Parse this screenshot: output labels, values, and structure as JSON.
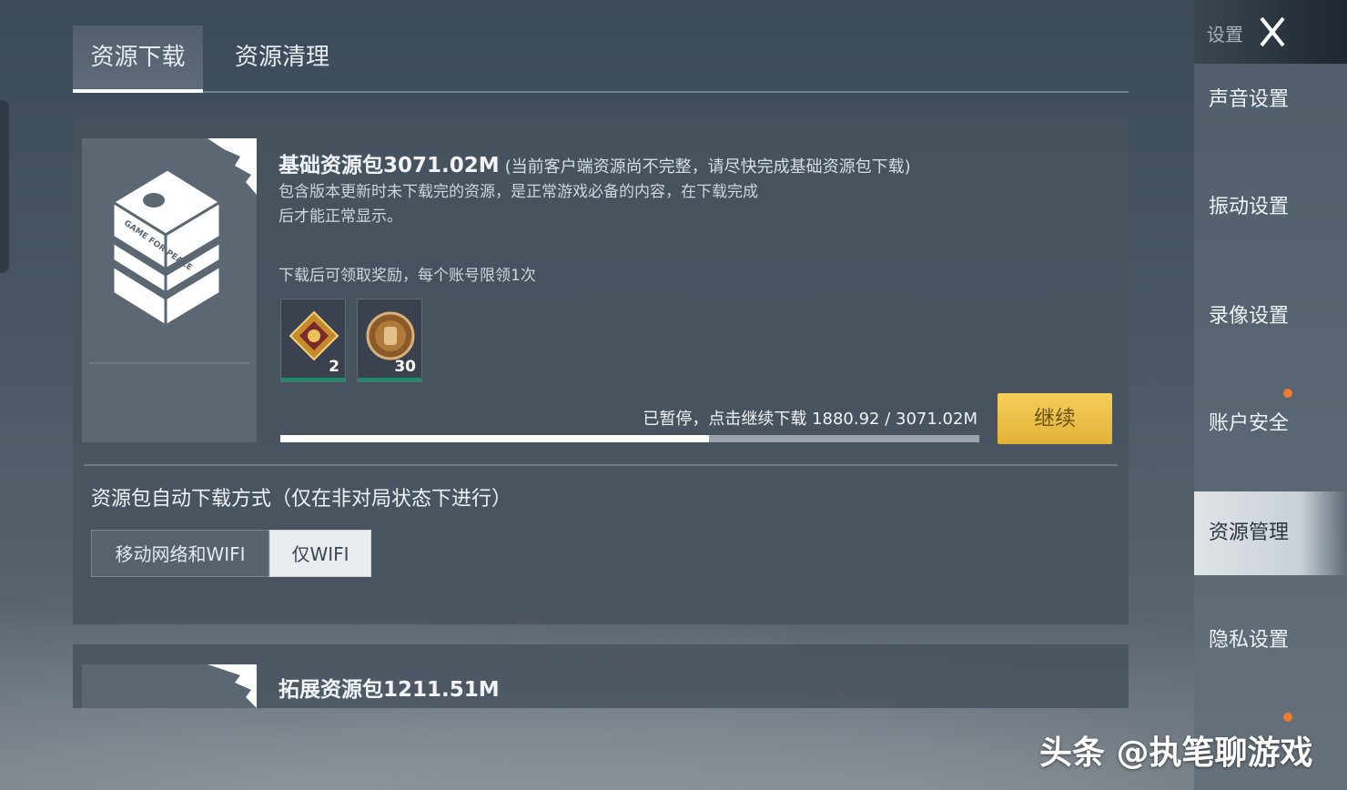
{
  "tabs": [
    {
      "label": "资源下载",
      "active": true
    },
    {
      "label": "资源清理",
      "active": false
    }
  ],
  "base_pack": {
    "title": "基础资源包3071.02M",
    "note": "(当前客户端资源尚不完整，请尽快完成基础资源包下载)",
    "description": "包含版本更新时未下载完的资源，是正常游戏必备的内容，在下载完成后才能正常显示。",
    "image_text": "GAME FOR PEACE",
    "reward_label": "下载后可领取奖励，每个账号限领1次",
    "rewards": [
      {
        "icon": "double-exp-card-icon",
        "count": "2"
      },
      {
        "icon": "armor-coin-icon",
        "count": "30"
      }
    ],
    "status": "已暂停，点击继续下载 1880.92 / 3071.02M",
    "progress": 0.613,
    "continue_label": "继续"
  },
  "auto_download": {
    "label": "资源包自动下载方式（仅在非对局状态下进行）",
    "options": [
      {
        "label": "移动网络和WIFI",
        "selected": false
      },
      {
        "label": "仅WIFI",
        "selected": true
      }
    ]
  },
  "ext_pack": {
    "title": "拓展资源包1211.51M"
  },
  "sidebar": {
    "header": "设置",
    "items": [
      {
        "label": "声音设置"
      },
      {
        "label": "振动设置"
      },
      {
        "label": "录像设置"
      },
      {
        "label": "账户安全"
      },
      {
        "label": "资源管理",
        "active": true
      },
      {
        "label": "隐私设置"
      }
    ],
    "notification_color": "#f07a2e"
  },
  "watermark": "头条 @执笔聊游戏"
}
